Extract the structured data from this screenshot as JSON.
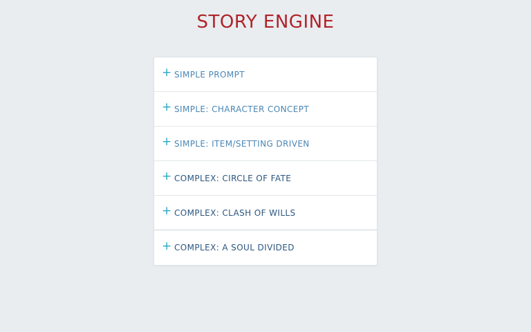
{
  "header": {
    "title": "STORY ENGINE"
  },
  "accordion": {
    "expand_icon": "+",
    "items": [
      {
        "label": "SIMPLE PROMPT",
        "kind": "simple"
      },
      {
        "label": "SIMPLE: CHARACTER CONCEPT",
        "kind": "simple"
      },
      {
        "label": "SIMPLE: ITEM/SETTING DRIVEN",
        "kind": "simple"
      },
      {
        "label": "COMPLEX: CIRCLE OF FATE",
        "kind": "complex"
      },
      {
        "label": "COMPLEX: CLASH OF WILLS",
        "kind": "complex"
      },
      {
        "label": "COMPLEX: A SOUL DIVIDED",
        "kind": "complex"
      }
    ]
  },
  "colors": {
    "background": "#e9edf0",
    "title": "#b0232a",
    "plus_icon": "#2aa7c4",
    "simple_label": "#4a86b4",
    "complex_label": "#2b5680"
  }
}
